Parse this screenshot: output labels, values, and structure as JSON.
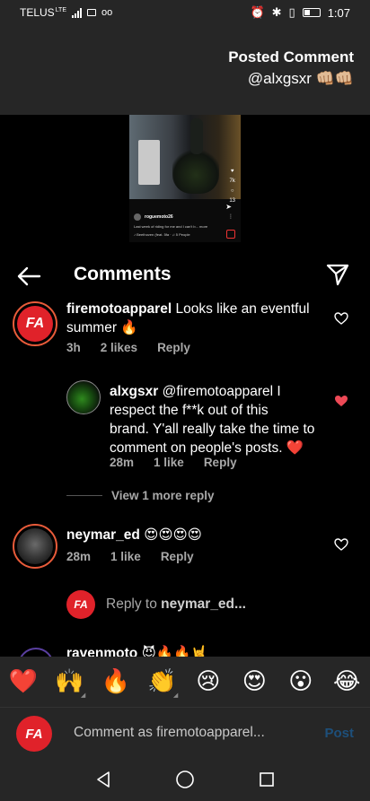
{
  "status_bar": {
    "carrier": "TELUS",
    "network": "LTE",
    "time": "1:07"
  },
  "banner": {
    "title": "Posted Comment",
    "user": "@alxgsxr 👊🏼👊🏼"
  },
  "thumbnail": {
    "username": "roguemoto26",
    "caption": "Last week of riding for me and I can't b... more",
    "music": "♪ Beethoven (feat. 5fa · ♫ 5 People",
    "count1": "7k",
    "count2": "13"
  },
  "header": {
    "title": "Comments"
  },
  "comments": [
    {
      "username": "firemotoapparel",
      "text": "Looks like an eventful summer 🔥",
      "time": "3h",
      "likes": "2 likes",
      "reply": "Reply",
      "avatar_label": "FA",
      "liked": false
    },
    {
      "username": "alxgsxr",
      "text_line1": "@firemotoapparel I",
      "text_line2": "respect the f**k out of this",
      "text_line3": "brand. Y'all really take the time to",
      "text_line4": "comment on people's posts. ❤️",
      "time": "28m",
      "likes": "1 like",
      "reply": "Reply",
      "liked": true
    },
    {
      "username": "neymar_ed",
      "text": "😍😍😍😍",
      "time": "28m",
      "likes": "1 like",
      "reply": "Reply",
      "liked": false
    },
    {
      "username": "ravenmoto",
      "text": "😈🔥🔥🤘"
    }
  ],
  "view_more": "View 1 more reply",
  "reply_to": {
    "prefix": "Reply to ",
    "user": "neymar_ed...",
    "avatar_label": "FA"
  },
  "emoji_bar": [
    "❤️",
    "🙌",
    "🔥",
    "👏",
    "😢",
    "😍",
    "😮",
    "😂"
  ],
  "input": {
    "placeholder": "Comment as firemotoapparel...",
    "post_label": "Post",
    "avatar_label": "FA"
  },
  "colors": {
    "accent_red": "#e0222a",
    "like_red": "#ed4956",
    "post_blue": "#1d4f7a",
    "bar_bg": "#262626"
  }
}
